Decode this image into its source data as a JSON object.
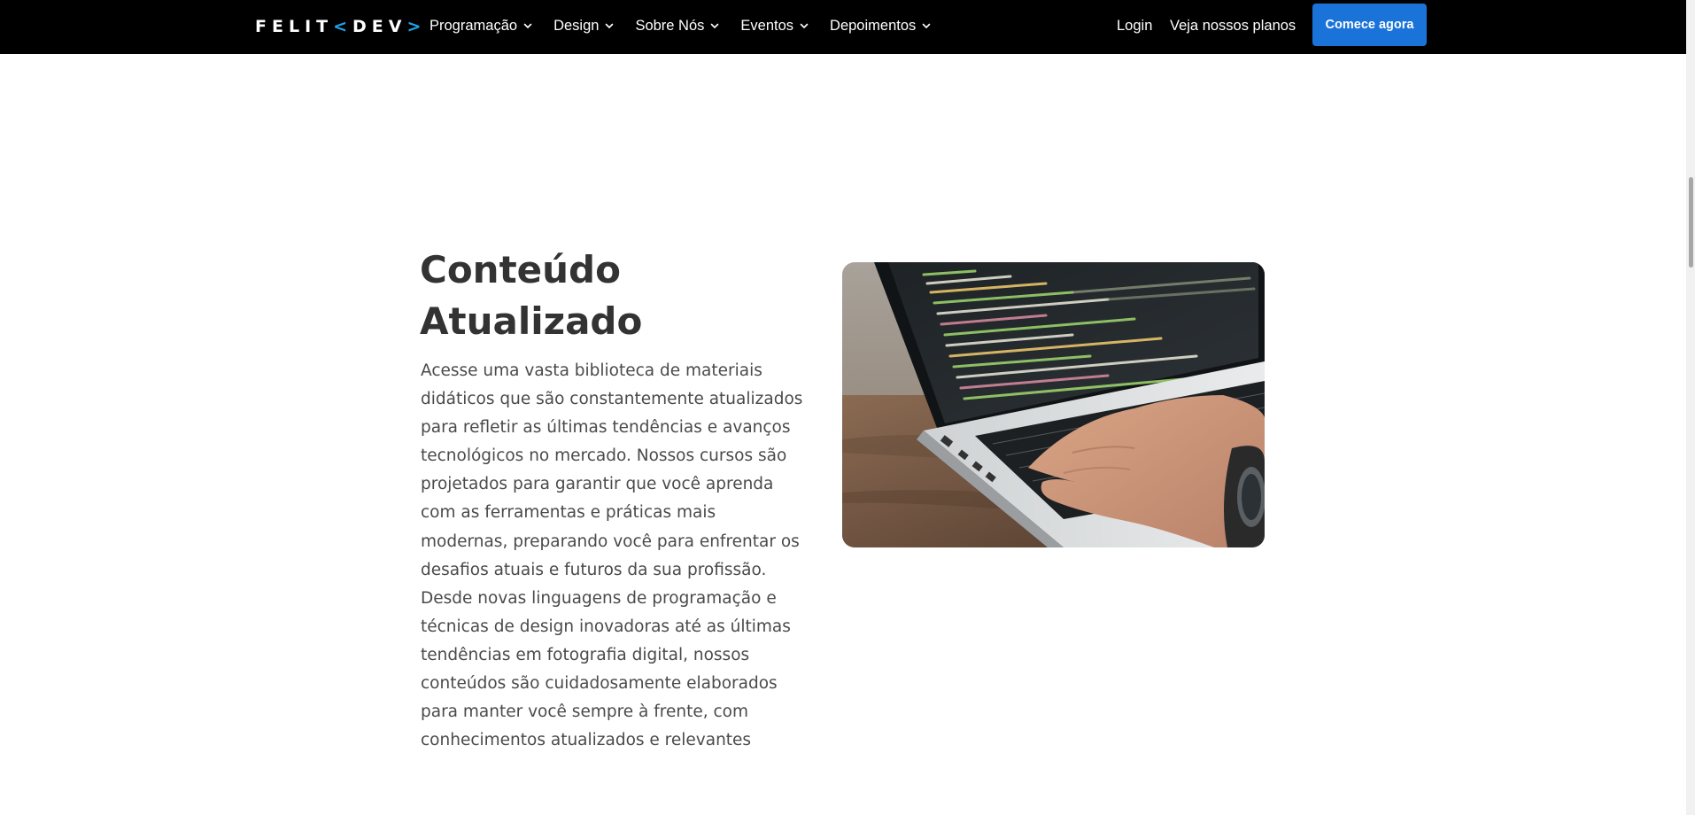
{
  "header": {
    "logo": {
      "part1": "FELIT",
      "part2": "<",
      "part3": "DEV",
      "part4": ">"
    },
    "nav": [
      {
        "label": "Programação",
        "icon": "chevron-down-icon"
      },
      {
        "label": "Design",
        "icon": "chevron-down-icon"
      },
      {
        "label": "Sobre Nós",
        "icon": "chevron-down-icon"
      },
      {
        "label": "Eventos",
        "icon": "chevron-down-icon"
      },
      {
        "label": "Depoimentos",
        "icon": "chevron-down-icon"
      }
    ],
    "login_label": "Login",
    "plans_label": "Veja nossos planos",
    "cta_label": "Comece agora"
  },
  "feature": {
    "title": "Conteúdo Atualizado",
    "description": "Acesse uma vasta biblioteca de materiais didáticos que são constantemente atualizados para refletir as últimas tendências e avanços tecnológicos no mercado. Nossos cursos são projetados para garantir que você aprenda com as ferramentas e práticas mais modernas, preparando você para enfrentar os desafios atuais e futuros da sua profissão. Desde novas linguagens de programação e técnicas de design inovadoras até as últimas tendências em fotografia digital, nossos conteúdos são cuidadosamente elaborados para manter você sempre à frente, com conhecimentos atualizados e relevantes",
    "image": "laptop-coding-photo"
  },
  "colors": {
    "header_bg": "#000000",
    "logo_accent": "#1fa3e8",
    "cta_bg": "#1a73d9",
    "heading": "#333333",
    "text": "#4a4a4a"
  }
}
